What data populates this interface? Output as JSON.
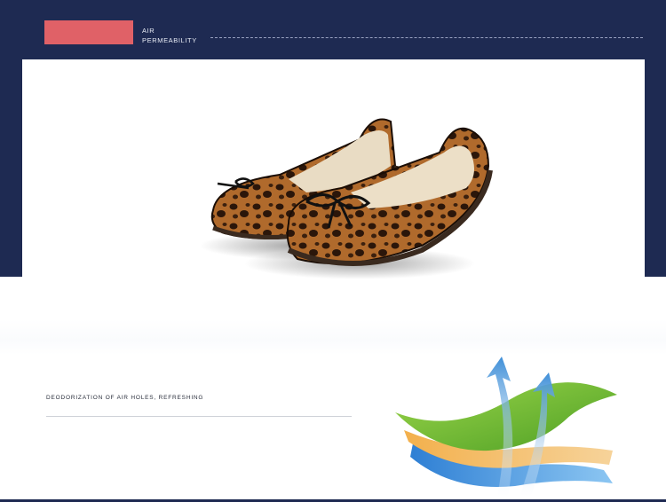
{
  "header": {
    "title_line1": "AIR",
    "title_line2": "PERMEABILITY",
    "accent_color": "#e06167",
    "background_color": "#1e2a52"
  },
  "feature": {
    "caption": "DEODORIZATION OF AIR HOLES, REFRESHING"
  },
  "illustration": {
    "layers": [
      "green",
      "orange",
      "blue"
    ],
    "arrows": 2
  }
}
